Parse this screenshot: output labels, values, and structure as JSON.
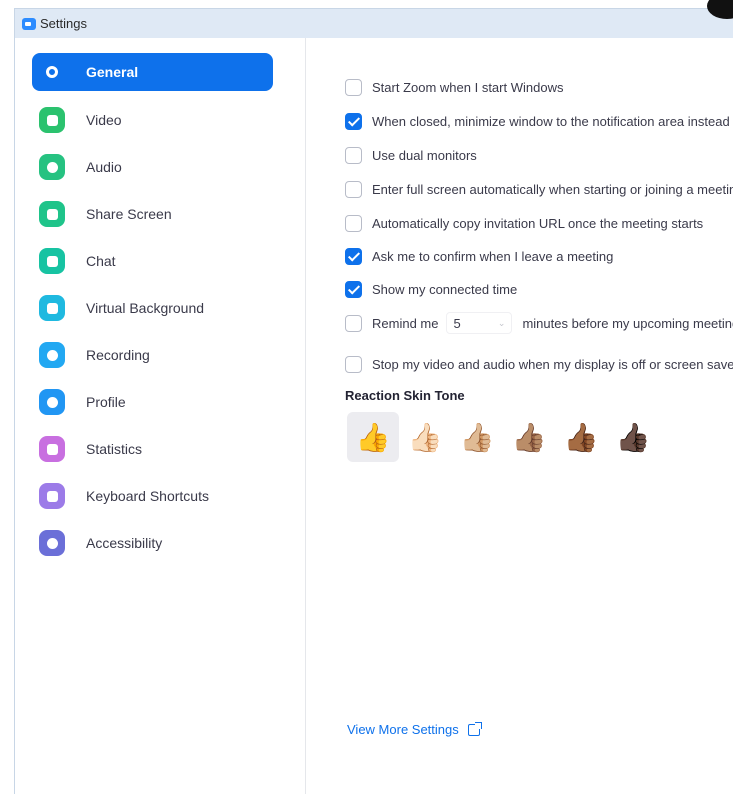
{
  "window": {
    "title": "Settings"
  },
  "sidebar": {
    "items": [
      {
        "label": "General",
        "icon": "gear-icon",
        "color": "#0e71eb",
        "active": true
      },
      {
        "label": "Video",
        "icon": "video-icon",
        "color": "#2bc26e"
      },
      {
        "label": "Audio",
        "icon": "headphones-icon",
        "color": "#26c281"
      },
      {
        "label": "Share Screen",
        "icon": "share-screen-icon",
        "color": "#1fc48a"
      },
      {
        "label": "Chat",
        "icon": "chat-icon",
        "color": "#17c3a2"
      },
      {
        "label": "Virtual Background",
        "icon": "virtual-background-icon",
        "color": "#1fb9e0"
      },
      {
        "label": "Recording",
        "icon": "recording-icon",
        "color": "#22a8f2"
      },
      {
        "label": "Profile",
        "icon": "profile-icon",
        "color": "#2196f3"
      },
      {
        "label": "Statistics",
        "icon": "statistics-icon",
        "color": "#c86fe0"
      },
      {
        "label": "Keyboard Shortcuts",
        "icon": "keyboard-icon",
        "color": "#9c7be8"
      },
      {
        "label": "Accessibility",
        "icon": "accessibility-icon",
        "color": "#6b6fd8"
      }
    ]
  },
  "general": {
    "options": [
      {
        "label": "Start Zoom when I start Windows",
        "checked": false
      },
      {
        "label": "When closed, minimize window to the notification area instead of the task bar",
        "checked": true
      },
      {
        "label": "Use dual monitors",
        "checked": false
      },
      {
        "label": "Enter full screen automatically when starting or joining a meeting",
        "checked": false
      },
      {
        "label": "Automatically copy invitation URL once the meeting starts",
        "checked": false
      },
      {
        "label": "Ask me to confirm when I leave a meeting",
        "checked": true
      },
      {
        "label": "Show my connected time",
        "checked": true
      }
    ],
    "remind": {
      "label": "Remind me",
      "value": "5",
      "suffix": "minutes before my upcoming meetings",
      "checked": false
    },
    "stop_video": {
      "label": "Stop my video and audio when my display is off or screen saver begins",
      "checked": false
    },
    "reaction_title": "Reaction Skin Tone",
    "skin_tones": [
      "👍",
      "👍🏻",
      "👍🏼",
      "👍🏽",
      "👍🏾",
      "👍🏿"
    ],
    "selected_tone": 0,
    "view_more": "View More Settings"
  },
  "colors": {
    "accent": "#0e71eb",
    "titlebar": "#dfe9f5"
  }
}
